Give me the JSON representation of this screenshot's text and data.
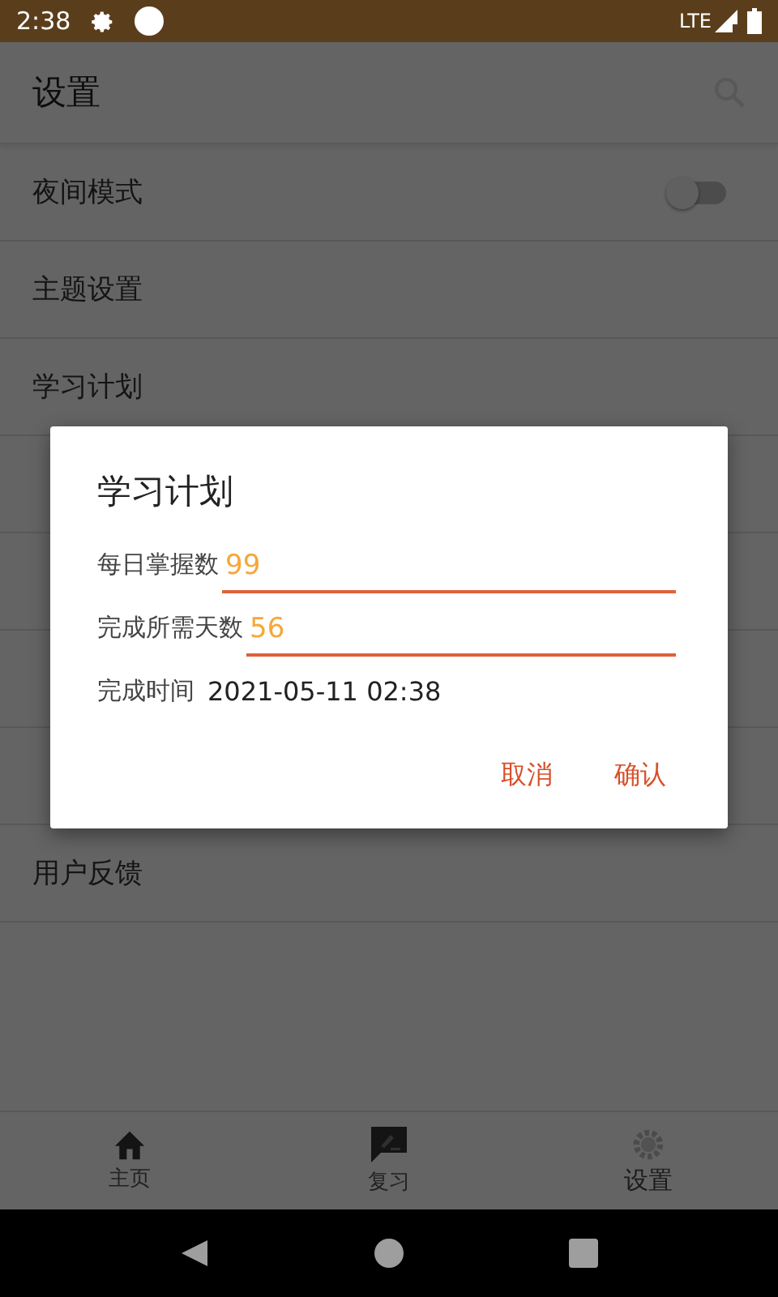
{
  "status_bar": {
    "time": "2:38",
    "network": "LTE"
  },
  "app_bar": {
    "title": "设置"
  },
  "settings": [
    {
      "label": "夜间模式",
      "kind": "switch",
      "on": false
    },
    {
      "label": "主题设置",
      "kind": "plain"
    },
    {
      "label": "学习计划",
      "kind": "plain"
    },
    {
      "kind": "covered"
    },
    {
      "kind": "covered"
    },
    {
      "kind": "covered"
    },
    {
      "kind": "covered"
    },
    {
      "label": "用户反馈",
      "kind": "plain"
    }
  ],
  "dialog": {
    "title": "学习计划",
    "fields": [
      {
        "label": "每日掌握数",
        "value": "99"
      },
      {
        "label": "完成所需天数",
        "value": "56"
      }
    ],
    "result": {
      "label": "完成时间",
      "value": "2021-05-11 02:38"
    },
    "buttons": [
      "取消",
      "确认"
    ]
  },
  "bottom_nav": [
    {
      "label": "主页",
      "selected": false
    },
    {
      "label": "复习",
      "selected": false
    },
    {
      "label": "设置",
      "selected": true
    }
  ]
}
